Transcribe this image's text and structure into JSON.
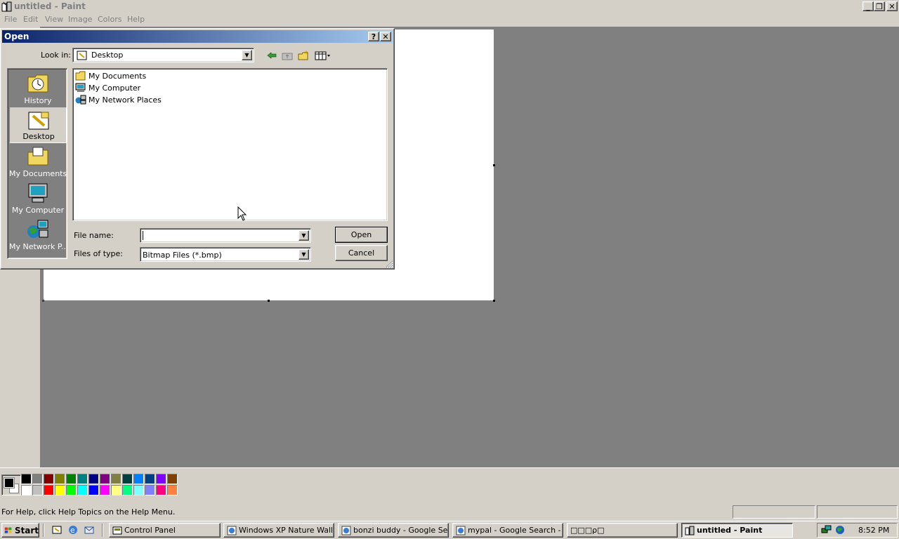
{
  "window": {
    "title": "untitled - Paint"
  },
  "menu": [
    "File",
    "Edit",
    "View",
    "Image",
    "Colors",
    "Help"
  ],
  "palette": {
    "top": [
      "#000000",
      "#808080",
      "#800000",
      "#808000",
      "#008000",
      "#008080",
      "#000080",
      "#800080",
      "#808040",
      "#004040",
      "#0080ff",
      "#004080",
      "#8000ff",
      "#804000"
    ],
    "bottom": [
      "#ffffff",
      "#c0c0c0",
      "#ff0000",
      "#ffff00",
      "#00ff00",
      "#00ffff",
      "#0000ff",
      "#ff00ff",
      "#ffff80",
      "#00ff80",
      "#80ffff",
      "#8080ff",
      "#ff0080",
      "#ff8040"
    ]
  },
  "status": {
    "text": "For Help, click Help Topics on the Help Menu."
  },
  "dialog": {
    "title": "Open",
    "help": "?",
    "look_in_label": "Look in:",
    "look_in_value": "Desktop",
    "places": [
      "History",
      "Desktop",
      "My Documents",
      "My Computer",
      "My Network P..."
    ],
    "files": [
      "My Documents",
      "My Computer",
      "My Network Places"
    ],
    "file_name_label": "File name:",
    "file_name_value": "",
    "files_of_type_label": "Files of type:",
    "files_of_type_value": "Bitmap Files (*.bmp)",
    "open_label": "Open",
    "cancel_label": "Cancel"
  },
  "taskbar": {
    "start": "Start",
    "buttons": [
      "Control Panel",
      "Windows XP Nature Wallp...",
      "bonzi buddy - Google Sea...",
      "mypal - Google Search - ...",
      "□□□ρ□",
      "untitled - Paint"
    ],
    "clock": "8:52 PM"
  }
}
